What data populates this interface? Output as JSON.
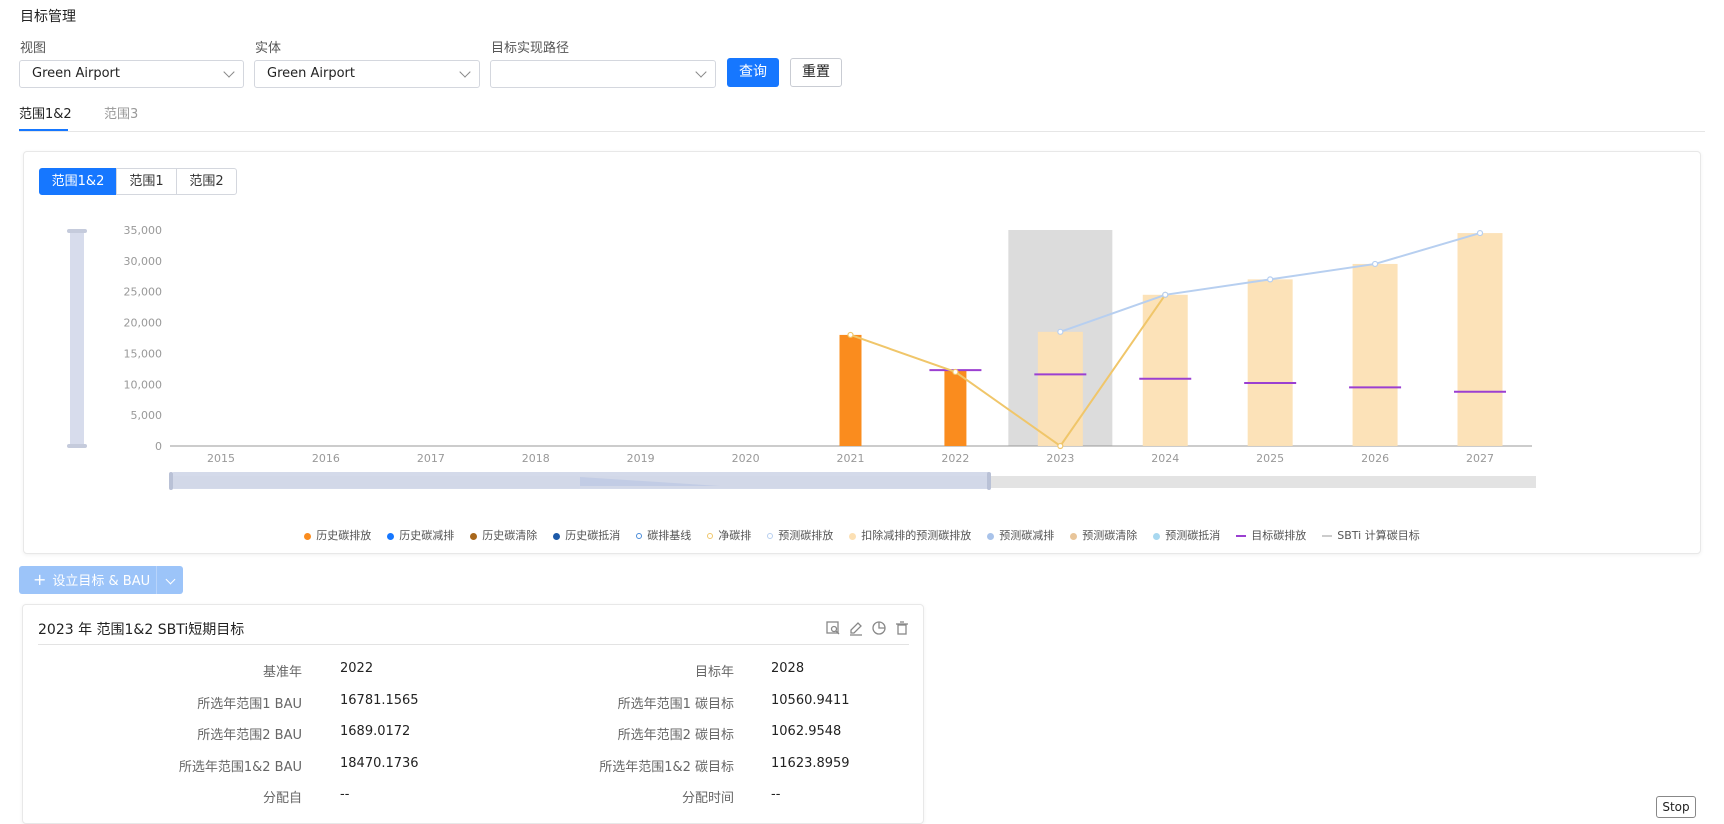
{
  "page": {
    "title": "目标管理"
  },
  "filters": {
    "view_label": "视图",
    "view_value": "Green Airport",
    "entity_label": "实体",
    "entity_value": "Green Airport",
    "path_label": "目标实现路径",
    "path_value": "",
    "query_button": "查询",
    "reset_button": "重置"
  },
  "tabs": [
    {
      "label": "范围1&2",
      "active": true
    },
    {
      "label": "范围3",
      "active": false
    }
  ],
  "scope_toggle": [
    {
      "label": "范围1&2",
      "active": true
    },
    {
      "label": "范围1",
      "active": false
    },
    {
      "label": "范围2",
      "active": false
    }
  ],
  "colors": {
    "accent": "#1677ff",
    "history_emission": "#fa8c1e",
    "forecast_after_reduction": "#fce0b4",
    "target_emission": "#9b3fd1",
    "net_emission": "#f0c66a",
    "forecast_emission": "#b7cff0",
    "highlight_band": "#dcdcdc"
  },
  "chart_data": {
    "type": "bar",
    "categories": [
      "2015",
      "2016",
      "2017",
      "2018",
      "2019",
      "2020",
      "2021",
      "2022",
      "2023",
      "2024",
      "2025",
      "2026",
      "2027"
    ],
    "ylim": [
      0,
      35000
    ],
    "yticks": [
      0,
      5000,
      10000,
      15000,
      20000,
      25000,
      30000,
      35000
    ],
    "ytick_labels": [
      "0",
      "5,000",
      "10,000",
      "15,000",
      "20,000",
      "25,000",
      "30,000",
      "35,000"
    ],
    "highlight_category": "2023",
    "series": [
      {
        "name": "历史碳排放",
        "kind": "bar",
        "color": "#fa8c1e",
        "values": [
          null,
          null,
          null,
          null,
          null,
          null,
          18000,
          12400,
          null,
          null,
          null,
          null,
          null
        ]
      },
      {
        "name": "扣除减排的预测碳排放",
        "kind": "bar",
        "color": "#fce0b4",
        "values": [
          null,
          null,
          null,
          null,
          null,
          null,
          null,
          null,
          18500,
          24500,
          27000,
          29500,
          34500
        ]
      },
      {
        "name": "目标碳排放",
        "kind": "dash",
        "color": "#9b3fd1",
        "values": [
          null,
          null,
          null,
          null,
          null,
          null,
          null,
          12300,
          11600,
          10900,
          10200,
          9500,
          8800
        ]
      },
      {
        "name": "净碳排",
        "kind": "line",
        "color": "#f0c66a",
        "values": [
          null,
          null,
          null,
          null,
          null,
          null,
          18000,
          12000,
          0,
          24500,
          null,
          null,
          null
        ]
      },
      {
        "name": "预测碳排放",
        "kind": "line",
        "color": "#b7cff0",
        "values": [
          null,
          null,
          null,
          null,
          null,
          null,
          null,
          null,
          18500,
          24500,
          27000,
          29500,
          34500
        ]
      }
    ],
    "legend": [
      {
        "name": "历史碳排放",
        "color": "#fa8c1e",
        "marker": "dot"
      },
      {
        "name": "历史碳减排",
        "color": "#1677ff",
        "marker": "dot"
      },
      {
        "name": "历史碳清除",
        "color": "#a8671b",
        "marker": "dot"
      },
      {
        "name": "历史碳抵消",
        "color": "#1d5aa8",
        "marker": "dot"
      },
      {
        "name": "碳排基线",
        "color": "#4a8cd9",
        "marker": "ring"
      },
      {
        "name": "净碳排",
        "color": "#f0c66a",
        "marker": "ring"
      },
      {
        "name": "预测碳排放",
        "color": "#b7cff0",
        "marker": "ring"
      },
      {
        "name": "扣除减排的预测碳排放",
        "color": "#fce0b4",
        "marker": "dot"
      },
      {
        "name": "预测碳减排",
        "color": "#a9c3ea",
        "marker": "dot"
      },
      {
        "name": "预测碳清除",
        "color": "#e8c59a",
        "marker": "dot"
      },
      {
        "name": "预测碳抵消",
        "color": "#a8d8f0",
        "marker": "dot"
      },
      {
        "name": "目标碳排放",
        "color": "#9b3fd1",
        "marker": "dash"
      },
      {
        "name": "SBTi 计算碳目标",
        "color": "#cccccc",
        "marker": "dash"
      }
    ]
  },
  "actions": {
    "add_target_label": "设立目标 & BAU"
  },
  "target_card": {
    "title": "2023 年 范围1&2 SBTi短期目标",
    "rows": [
      {
        "l_label": "基准年",
        "l_value": "2022",
        "r_label": "目标年",
        "r_value": "2028"
      },
      {
        "l_label": "所选年范围1 BAU",
        "l_value": "16781.1565",
        "r_label": "所选年范围1 碳目标",
        "r_value": "10560.9411"
      },
      {
        "l_label": "所选年范围2 BAU",
        "l_value": "1689.0172",
        "r_label": "所选年范围2 碳目标",
        "r_value": "1062.9548"
      },
      {
        "l_label": "所选年范围1&2 BAU",
        "l_value": "18470.1736",
        "r_label": "所选年范围1&2 碳目标",
        "r_value": "11623.8959"
      },
      {
        "l_label": "分配自",
        "l_value": "--",
        "r_label": "分配时间",
        "r_value": "--"
      }
    ]
  },
  "overlay": {
    "stop_label": "Stop"
  }
}
